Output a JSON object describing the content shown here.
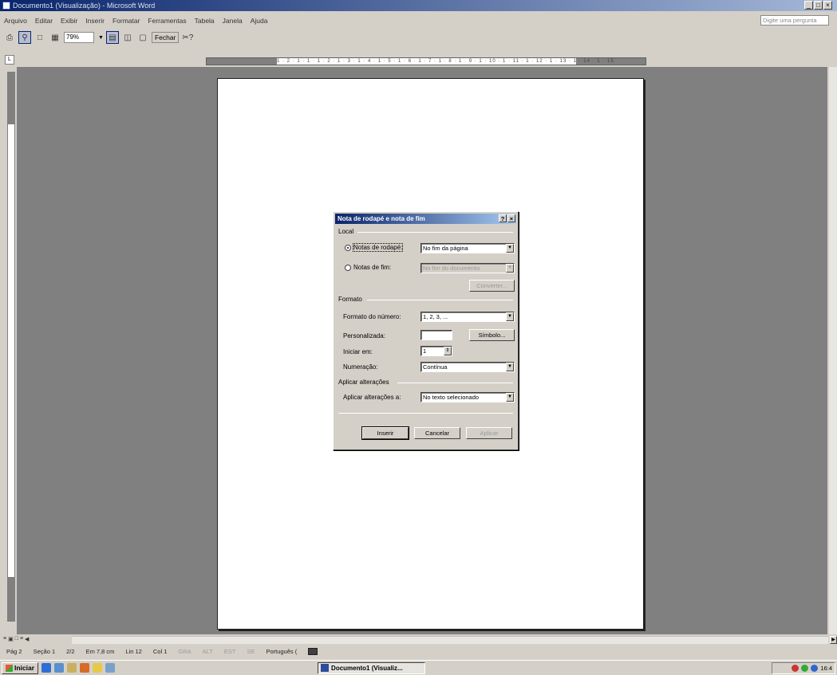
{
  "window": {
    "title": "Documento1 (Visualização) - Microsoft Word",
    "controls": [
      "_",
      "□",
      "×"
    ]
  },
  "menubar": {
    "items": [
      "Arquivo",
      "Editar",
      "Exibir",
      "Inserir",
      "Formatar",
      "Ferramentas",
      "Tabela",
      "Janela",
      "Ajuda"
    ],
    "ask_placeholder": "Digite uma pergunta"
  },
  "toolbar": {
    "zoom": "79%",
    "close_label": "Fechar",
    "help_label": "✂?"
  },
  "ruler": {
    "numbers": "1 · 2 · 1 · 1 · 1 · 2 · 1 · 3 · 1 · 4 · 1 · 5 · 1 · 6 · 1 · 7 · 1 · 8 · 1 · 9 · 1 · 10 · 1 · 11 · 1 · 12 · 1 · 13 · 1 · 14 · 1 · 15"
  },
  "dialog": {
    "title": "Nota de rodapé e nota de fim",
    "title_controls": [
      "?",
      "×"
    ],
    "local": {
      "group_label": "Local",
      "footnotes_label": "Notas de rodapé:",
      "footnotes_value": "No fim da página",
      "endnotes_label": "Notas de fim:",
      "endnotes_value": "No fim do documento",
      "convert_button": "Converter..."
    },
    "format": {
      "group_label": "Formato",
      "number_format_label": "Formato do número:",
      "number_format_value": "1, 2, 3, ...",
      "custom_mark_label": "Personalizada:",
      "custom_mark_value": "",
      "symbol_button": "Símbolo...",
      "start_at_label": "Iniciar em:",
      "start_at_value": "1",
      "numbering_label": "Numeração:",
      "numbering_value": "Contínua"
    },
    "apply": {
      "group_label": "Aplicar alterações",
      "apply_to_label": "Aplicar alterações a:",
      "apply_to_value": "No texto selecionado"
    },
    "buttons": {
      "insert": "Inserir",
      "cancel": "Cancelar",
      "apply": "Aplicar"
    }
  },
  "statusbar": {
    "page": "Pág 2",
    "section": "Seção 1",
    "page_of": "2/2",
    "position": "Em 7,8 cm",
    "line": "Lin 12",
    "column": "Col 1",
    "gra": "GRA",
    "alt": "ALT",
    "est": "EST",
    "se": "SE",
    "language": "Português ("
  },
  "taskbar": {
    "start_label": "Iniciar",
    "task_label": "Documento1 (Visualiz...",
    "clock": "16:4"
  },
  "colors": {
    "titlebar": "#08246b",
    "dialog_title": "#0a246a",
    "workspace": "#808080",
    "chrome": "#d4d0c8"
  }
}
